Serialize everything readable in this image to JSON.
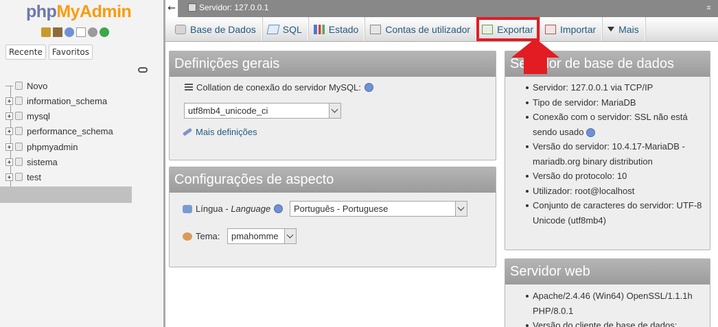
{
  "logo": {
    "part1": "php",
    "part2": "MyAdmin"
  },
  "nav": {
    "tabs": [
      "Recente",
      "Favoritos"
    ],
    "tree": [
      {
        "label": "Novo",
        "expandable": false
      },
      {
        "label": "information_schema",
        "expandable": true
      },
      {
        "label": "mysql",
        "expandable": true
      },
      {
        "label": "performance_schema",
        "expandable": true
      },
      {
        "label": "phpmyadmin",
        "expandable": true
      },
      {
        "label": "sistema",
        "expandable": true
      },
      {
        "label": "test",
        "expandable": true
      }
    ]
  },
  "topbar": {
    "back": "←",
    "server": "Servidor: 127.0.0.1",
    "collapse": "⌅"
  },
  "menu": [
    {
      "label": "Base de Dados",
      "icon": "database-icon"
    },
    {
      "label": "SQL",
      "icon": "sql-icon"
    },
    {
      "label": "Estado",
      "icon": "status-icon"
    },
    {
      "label": "Contas de utilizador",
      "icon": "users-icon"
    },
    {
      "label": "Exportar",
      "icon": "export-icon",
      "highlighted": true
    },
    {
      "label": "Importar",
      "icon": "import-icon"
    },
    {
      "label": "Mais",
      "icon": "chevron-down-icon"
    }
  ],
  "general": {
    "title": "Definições gerais",
    "collation_label": "Collation de conexão do servidor MySQL:",
    "collation_value": "utf8mb4_unicode_ci",
    "more_settings": "Mais definições"
  },
  "appearance": {
    "title": "Configurações de aspecto",
    "language_label": "Língua - ",
    "language_label_italic": "Language",
    "language_value": "Português - Portuguese",
    "theme_label": "Tema:",
    "theme_value": "pmahomme"
  },
  "db_server": {
    "title": "Servidor de base de dados",
    "items": [
      "Servidor: 127.0.0.1 via TCP/IP",
      "Tipo de servidor: MariaDB",
      "Conexão com o servidor: SSL não está sendo usado",
      "Versão do servidor: 10.4.17-MariaDB - mariadb.org binary distribution",
      "Versão do protocolo: 10",
      "Utilizador: root@localhost",
      "Conjunto de caracteres do servidor: UTF-8 Unicode (utf8mb4)"
    ]
  },
  "web_server": {
    "title": "Servidor web",
    "items": [
      "Apache/2.4.46 (Win64) OpenSSL/1.1.1h PHP/8.0.1",
      "Versão do cliente de base de dados:"
    ]
  },
  "colors": {
    "accent_link": "#235a81",
    "highlight": "#e31b23",
    "panel_header": "#a3a3a3"
  }
}
